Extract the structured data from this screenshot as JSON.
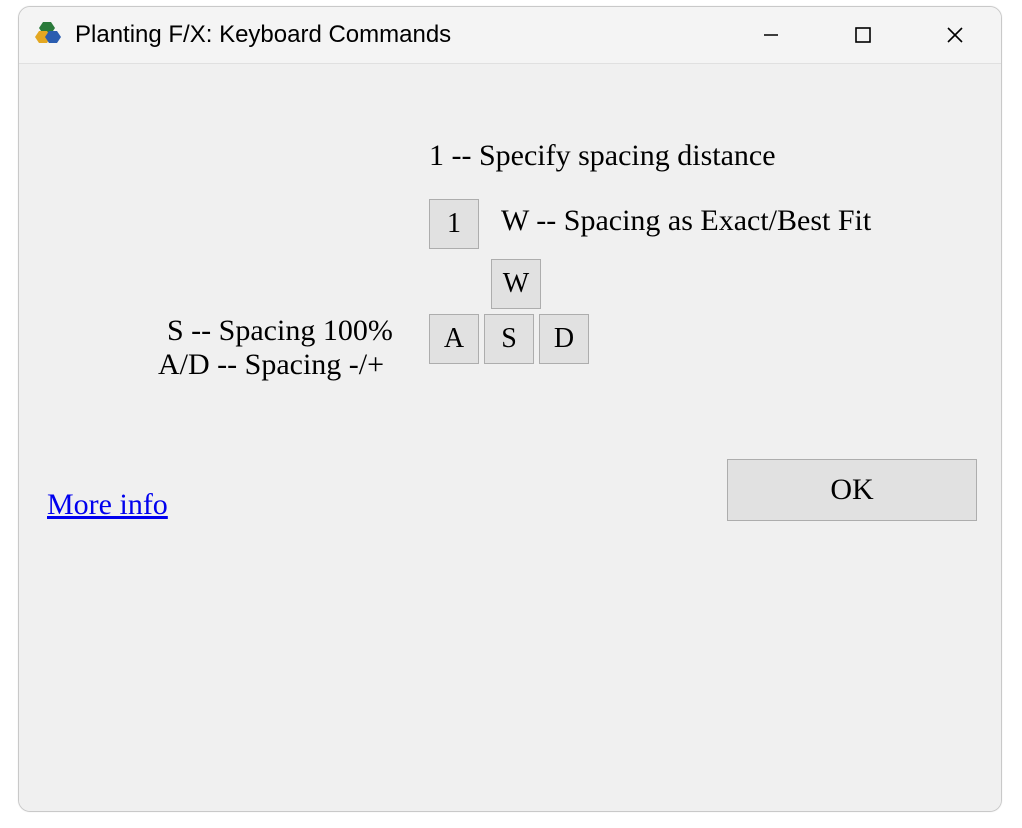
{
  "window": {
    "title": "Planting F/X: Keyboard Commands"
  },
  "labels": {
    "key1": "1 -- Specify spacing distance",
    "keyW": "W -- Spacing as Exact/Best Fit",
    "keyS": "S -- Spacing 100%",
    "keyAD": "A/D -- Spacing -/+"
  },
  "keys": {
    "k1": "1",
    "kW": "W",
    "kA": "A",
    "kS": "S",
    "kD": "D"
  },
  "footer": {
    "more_info": "More info",
    "ok": "OK"
  }
}
